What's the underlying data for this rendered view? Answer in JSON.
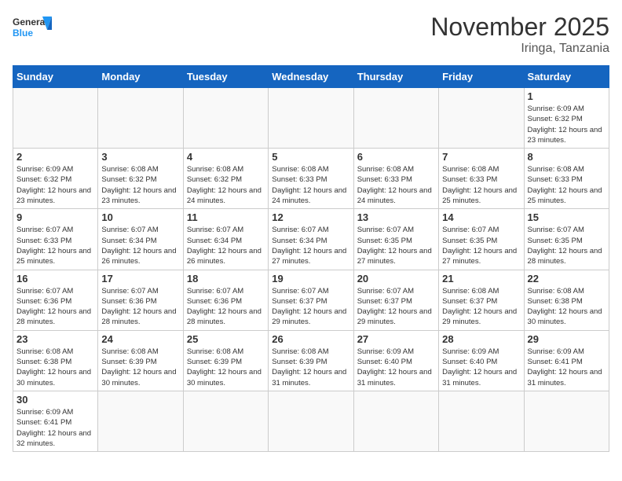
{
  "header": {
    "logo_general": "General",
    "logo_blue": "Blue",
    "month": "November 2025",
    "location": "Iringa, Tanzania"
  },
  "days_of_week": [
    "Sunday",
    "Monday",
    "Tuesday",
    "Wednesday",
    "Thursday",
    "Friday",
    "Saturday"
  ],
  "weeks": [
    [
      {
        "day": "",
        "info": ""
      },
      {
        "day": "",
        "info": ""
      },
      {
        "day": "",
        "info": ""
      },
      {
        "day": "",
        "info": ""
      },
      {
        "day": "",
        "info": ""
      },
      {
        "day": "",
        "info": ""
      },
      {
        "day": "1",
        "info": "Sunrise: 6:09 AM\nSunset: 6:32 PM\nDaylight: 12 hours and 23 minutes."
      }
    ],
    [
      {
        "day": "2",
        "info": "Sunrise: 6:09 AM\nSunset: 6:32 PM\nDaylight: 12 hours and 23 minutes."
      },
      {
        "day": "3",
        "info": "Sunrise: 6:08 AM\nSunset: 6:32 PM\nDaylight: 12 hours and 23 minutes."
      },
      {
        "day": "4",
        "info": "Sunrise: 6:08 AM\nSunset: 6:32 PM\nDaylight: 12 hours and 24 minutes."
      },
      {
        "day": "5",
        "info": "Sunrise: 6:08 AM\nSunset: 6:33 PM\nDaylight: 12 hours and 24 minutes."
      },
      {
        "day": "6",
        "info": "Sunrise: 6:08 AM\nSunset: 6:33 PM\nDaylight: 12 hours and 24 minutes."
      },
      {
        "day": "7",
        "info": "Sunrise: 6:08 AM\nSunset: 6:33 PM\nDaylight: 12 hours and 25 minutes."
      },
      {
        "day": "8",
        "info": "Sunrise: 6:08 AM\nSunset: 6:33 PM\nDaylight: 12 hours and 25 minutes."
      }
    ],
    [
      {
        "day": "9",
        "info": "Sunrise: 6:07 AM\nSunset: 6:33 PM\nDaylight: 12 hours and 25 minutes."
      },
      {
        "day": "10",
        "info": "Sunrise: 6:07 AM\nSunset: 6:34 PM\nDaylight: 12 hours and 26 minutes."
      },
      {
        "day": "11",
        "info": "Sunrise: 6:07 AM\nSunset: 6:34 PM\nDaylight: 12 hours and 26 minutes."
      },
      {
        "day": "12",
        "info": "Sunrise: 6:07 AM\nSunset: 6:34 PM\nDaylight: 12 hours and 27 minutes."
      },
      {
        "day": "13",
        "info": "Sunrise: 6:07 AM\nSunset: 6:35 PM\nDaylight: 12 hours and 27 minutes."
      },
      {
        "day": "14",
        "info": "Sunrise: 6:07 AM\nSunset: 6:35 PM\nDaylight: 12 hours and 27 minutes."
      },
      {
        "day": "15",
        "info": "Sunrise: 6:07 AM\nSunset: 6:35 PM\nDaylight: 12 hours and 28 minutes."
      }
    ],
    [
      {
        "day": "16",
        "info": "Sunrise: 6:07 AM\nSunset: 6:36 PM\nDaylight: 12 hours and 28 minutes."
      },
      {
        "day": "17",
        "info": "Sunrise: 6:07 AM\nSunset: 6:36 PM\nDaylight: 12 hours and 28 minutes."
      },
      {
        "day": "18",
        "info": "Sunrise: 6:07 AM\nSunset: 6:36 PM\nDaylight: 12 hours and 28 minutes."
      },
      {
        "day": "19",
        "info": "Sunrise: 6:07 AM\nSunset: 6:37 PM\nDaylight: 12 hours and 29 minutes."
      },
      {
        "day": "20",
        "info": "Sunrise: 6:07 AM\nSunset: 6:37 PM\nDaylight: 12 hours and 29 minutes."
      },
      {
        "day": "21",
        "info": "Sunrise: 6:08 AM\nSunset: 6:37 PM\nDaylight: 12 hours and 29 minutes."
      },
      {
        "day": "22",
        "info": "Sunrise: 6:08 AM\nSunset: 6:38 PM\nDaylight: 12 hours and 30 minutes."
      }
    ],
    [
      {
        "day": "23",
        "info": "Sunrise: 6:08 AM\nSunset: 6:38 PM\nDaylight: 12 hours and 30 minutes."
      },
      {
        "day": "24",
        "info": "Sunrise: 6:08 AM\nSunset: 6:39 PM\nDaylight: 12 hours and 30 minutes."
      },
      {
        "day": "25",
        "info": "Sunrise: 6:08 AM\nSunset: 6:39 PM\nDaylight: 12 hours and 30 minutes."
      },
      {
        "day": "26",
        "info": "Sunrise: 6:08 AM\nSunset: 6:39 PM\nDaylight: 12 hours and 31 minutes."
      },
      {
        "day": "27",
        "info": "Sunrise: 6:09 AM\nSunset: 6:40 PM\nDaylight: 12 hours and 31 minutes."
      },
      {
        "day": "28",
        "info": "Sunrise: 6:09 AM\nSunset: 6:40 PM\nDaylight: 12 hours and 31 minutes."
      },
      {
        "day": "29",
        "info": "Sunrise: 6:09 AM\nSunset: 6:41 PM\nDaylight: 12 hours and 31 minutes."
      }
    ],
    [
      {
        "day": "30",
        "info": "Sunrise: 6:09 AM\nSunset: 6:41 PM\nDaylight: 12 hours and 32 minutes."
      },
      {
        "day": "",
        "info": ""
      },
      {
        "day": "",
        "info": ""
      },
      {
        "day": "",
        "info": ""
      },
      {
        "day": "",
        "info": ""
      },
      {
        "day": "",
        "info": ""
      },
      {
        "day": "",
        "info": ""
      }
    ]
  ]
}
